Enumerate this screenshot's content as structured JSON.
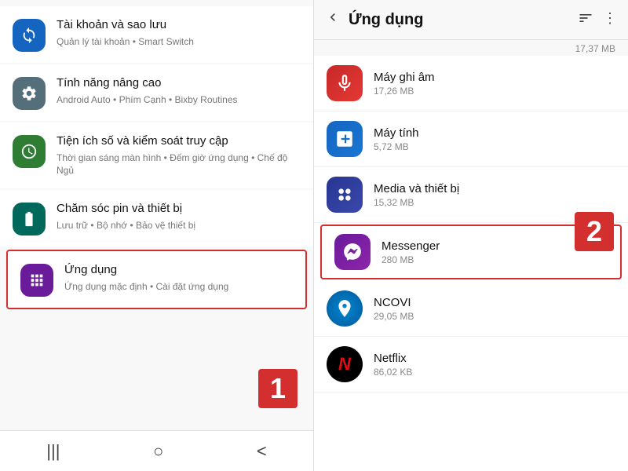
{
  "left": {
    "items": [
      {
        "id": "tai-khoan",
        "title": "Tài khoản và sao lưu",
        "subtitle": "Quản lý tài khoản • Smart Switch",
        "iconColor": "icon-blue",
        "iconSymbol": "🔄"
      },
      {
        "id": "tinh-nang",
        "title": "Tính năng nâng cao",
        "subtitle": "Android Auto • Phím Cạnh • Bixby Routines",
        "iconColor": "icon-gray",
        "iconSymbol": "⚙"
      },
      {
        "id": "tien-ich",
        "title": "Tiện ích số và kiểm soát truy cập",
        "subtitle": "Thời gian sáng màn hình • Đếm giờ ứng dụng • Chế độ Ngủ",
        "iconColor": "icon-green",
        "iconSymbol": "🕒"
      },
      {
        "id": "cham-soc",
        "title": "Chăm sóc pin và thiết bị",
        "subtitle": "Lưu trữ • Bộ nhớ • Bảo vệ thiết bị",
        "iconColor": "icon-teal",
        "iconSymbol": "🔋"
      },
      {
        "id": "ung-dung",
        "title": "Ứng dụng",
        "subtitle": "Ứng dụng mặc định • Cài đặt ứng dụng",
        "iconColor": "icon-purple",
        "iconSymbol": "⋮⋮",
        "highlighted": true
      }
    ],
    "nav": {
      "back": "|||",
      "home": "○",
      "recent": "<"
    },
    "badge": "1"
  },
  "right": {
    "header": {
      "back": "<",
      "title": "Ứng dụng",
      "filterIcon": "≡☰",
      "moreIcon": "⋮"
    },
    "scrollHint": "17,37 MB",
    "apps": [
      {
        "id": "may-ghi-am",
        "name": "Máy ghi âm",
        "size": "17,26 MB",
        "iconClass": "icon-recorder",
        "symbol": "🎙"
      },
      {
        "id": "may-tinh",
        "name": "Máy tính",
        "size": "5,72 MB",
        "iconClass": "icon-calculator",
        "symbol": "🧮"
      },
      {
        "id": "media",
        "name": "Media và thiết bị",
        "size": "15,32 MB",
        "iconClass": "icon-media",
        "symbol": "📱"
      },
      {
        "id": "messenger",
        "name": "Messenger",
        "size": "280 MB",
        "iconClass": "icon-messenger",
        "symbol": "💬",
        "highlighted": true
      },
      {
        "id": "ncovi",
        "name": "NCOVI",
        "size": "29,05 MB",
        "iconClass": "icon-ncovi",
        "symbol": "🌐"
      },
      {
        "id": "netflix",
        "name": "Netflix",
        "size": "86,02 KB",
        "iconClass": "icon-netflix",
        "symbol": "N"
      }
    ],
    "badge": "2"
  }
}
